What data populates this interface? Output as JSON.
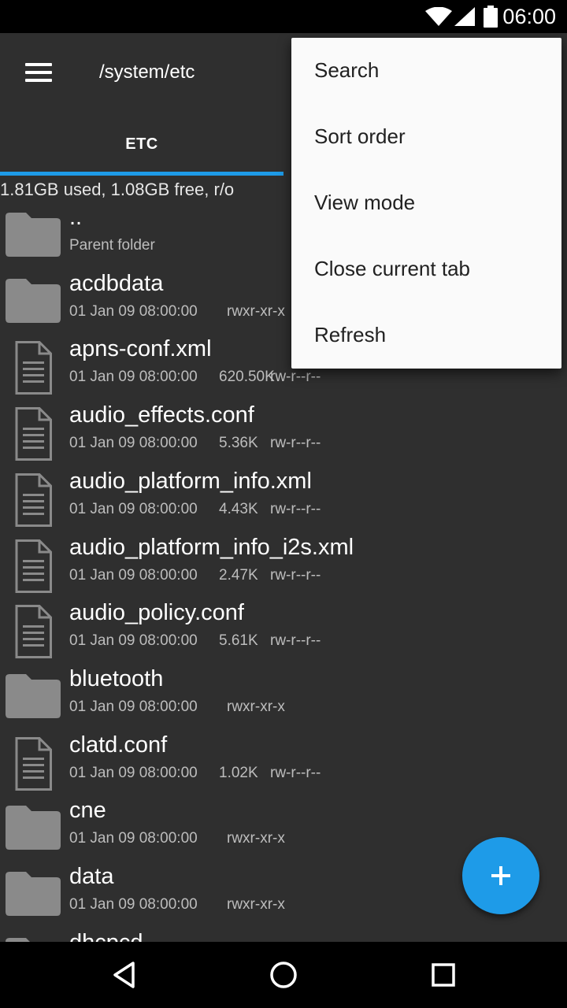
{
  "status_bar": {
    "time": "06:00"
  },
  "toolbar": {
    "path": "/system/etc"
  },
  "tabs": [
    {
      "label": "ETC"
    }
  ],
  "storage_info": "1.81GB used, 1.08GB free, r/o",
  "files": [
    {
      "name": "..",
      "type": "folder",
      "subtitle": "Parent folder"
    },
    {
      "name": "acdbdata",
      "type": "folder",
      "date": "01 Jan 09 08:00:00",
      "size": "",
      "perms": "rwxr-xr-x"
    },
    {
      "name": "apns-conf.xml",
      "type": "file",
      "date": "01 Jan 09 08:00:00",
      "size": "620.50K",
      "perms": "rw-r--r--"
    },
    {
      "name": "audio_effects.conf",
      "type": "file",
      "date": "01 Jan 09 08:00:00",
      "size": "5.36K",
      "perms": "rw-r--r--"
    },
    {
      "name": "audio_platform_info.xml",
      "type": "file",
      "date": "01 Jan 09 08:00:00",
      "size": "4.43K",
      "perms": "rw-r--r--"
    },
    {
      "name": "audio_platform_info_i2s.xml",
      "type": "file",
      "date": "01 Jan 09 08:00:00",
      "size": "2.47K",
      "perms": "rw-r--r--"
    },
    {
      "name": "audio_policy.conf",
      "type": "file",
      "date": "01 Jan 09 08:00:00",
      "size": "5.61K",
      "perms": "rw-r--r--"
    },
    {
      "name": "bluetooth",
      "type": "folder",
      "date": "01 Jan 09 08:00:00",
      "size": "",
      "perms": "rwxr-xr-x"
    },
    {
      "name": "clatd.conf",
      "type": "file",
      "date": "01 Jan 09 08:00:00",
      "size": "1.02K",
      "perms": "rw-r--r--"
    },
    {
      "name": "cne",
      "type": "folder",
      "date": "01 Jan 09 08:00:00",
      "size": "",
      "perms": "rwxr-xr-x"
    },
    {
      "name": "data",
      "type": "folder",
      "date": "01 Jan 09 08:00:00",
      "size": "",
      "perms": "rwxr-xr-x"
    },
    {
      "name": "dhcpcd",
      "type": "folder",
      "date": "",
      "size": "",
      "perms": ""
    }
  ],
  "overflow_menu": {
    "items": [
      {
        "label": "Search"
      },
      {
        "label": "Sort order"
      },
      {
        "label": "View mode"
      },
      {
        "label": "Close current tab"
      },
      {
        "label": "Refresh"
      }
    ]
  },
  "icons": {
    "menu": "hamburger-icon",
    "folder": "folder-icon",
    "file": "file-icon",
    "fab": "plus-icon",
    "nav": [
      "back-icon",
      "home-icon",
      "recents-icon"
    ]
  },
  "colors": {
    "accent": "#1e9be8",
    "background": "#2f2f2f",
    "menu_bg": "#fafafa",
    "icon_grey": "#8a8a8a"
  }
}
